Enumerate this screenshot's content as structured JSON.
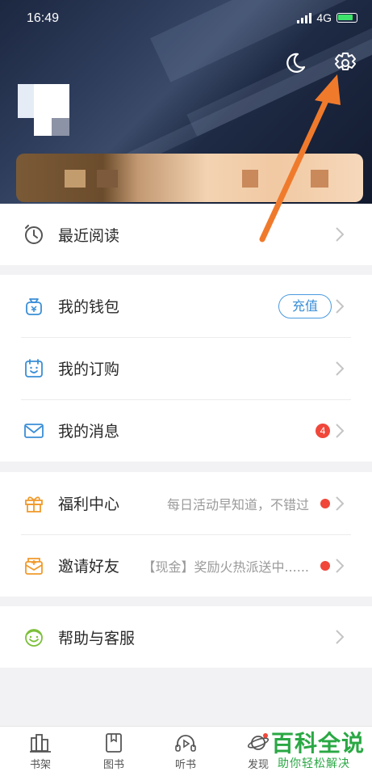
{
  "status_bar": {
    "time": "16:49",
    "network": "4G"
  },
  "colors": {
    "accent_blue": "#3a8ed6",
    "badge_red": "#f0473a",
    "arrow_orange": "#f07a2c",
    "watermark_green": "#2aa844"
  },
  "header": {
    "night_mode_icon": "moon-icon",
    "settings_icon": "gear-icon"
  },
  "menu_recent": {
    "label": "最近阅读",
    "icon": "clock-icon"
  },
  "menu_account": [
    {
      "label": "我的钱包",
      "icon": "wallet-icon",
      "button": "充值"
    },
    {
      "label": "我的订购",
      "icon": "calendar-smile-icon"
    },
    {
      "label": "我的消息",
      "icon": "mail-icon",
      "badge": "4"
    }
  ],
  "menu_benefits": [
    {
      "label": "福利中心",
      "icon": "gift-icon",
      "hint": "每日活动早知道，不错过"
    },
    {
      "label": "邀请好友",
      "icon": "invite-icon",
      "hint": "【现金】奖励火热派送中......"
    }
  ],
  "menu_help": {
    "label": "帮助与客服",
    "icon": "support-face-icon"
  },
  "bottom_nav": [
    {
      "label": "书架",
      "icon": "bookshelf-icon"
    },
    {
      "label": "图书",
      "icon": "book-icon"
    },
    {
      "label": "听书",
      "icon": "headphone-play-icon"
    },
    {
      "label": "发现",
      "icon": "planet-icon"
    }
  ],
  "watermark": {
    "title": "百科全说",
    "subtitle": "助你轻松解决"
  }
}
